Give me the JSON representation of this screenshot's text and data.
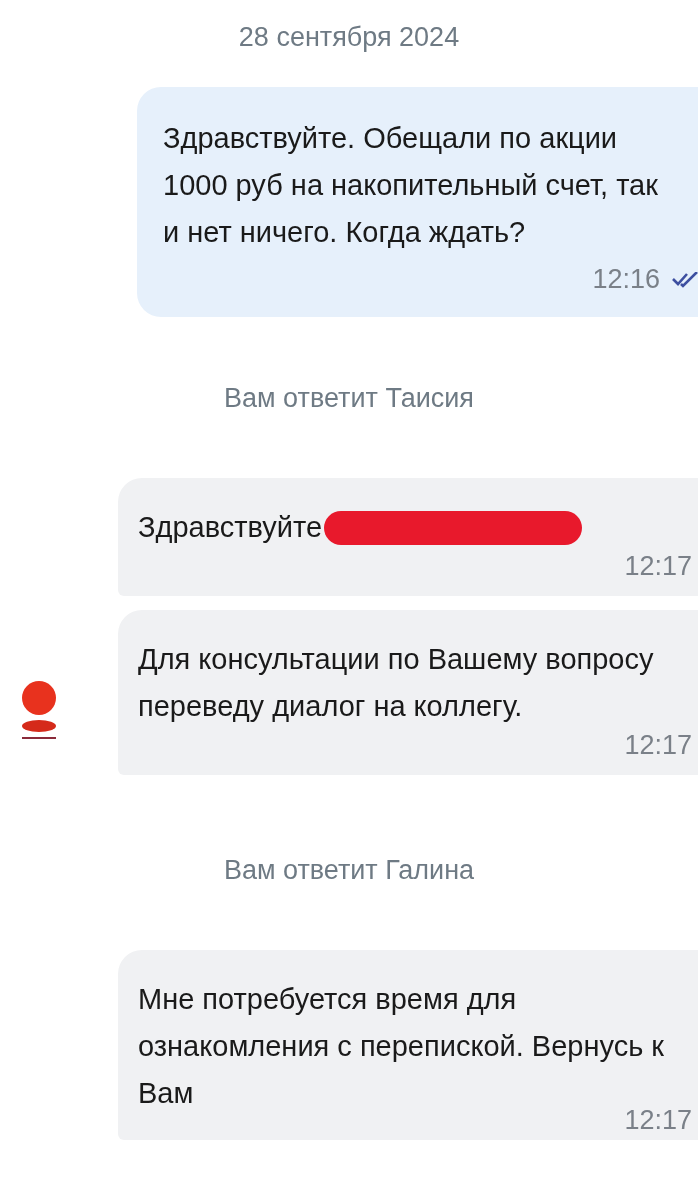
{
  "messages": [
    {
      "kind": "date",
      "text": "28 сентября 2024"
    },
    {
      "kind": "outgoing",
      "text": "Здравствуйте. Обещали по акции 1000 руб на накопительный счет, так и нет ничего. Когда ждать?",
      "time": "12:16",
      "read": true
    },
    {
      "kind": "system",
      "text": "Вам ответит Таисия"
    },
    {
      "kind": "incoming",
      "text": "Здравствуйте",
      "redacted": true,
      "avatar": false,
      "time": "12:17"
    },
    {
      "kind": "incoming",
      "text": "Для консультации по Вашему вопросу переведу диалог на коллегу.",
      "redacted": false,
      "avatar": true,
      "time": "12:17"
    },
    {
      "kind": "system",
      "text": "Вам ответит Галина"
    },
    {
      "kind": "incoming",
      "text": "Мне потребуется время для ознакомления с перепиской. Вернусь к Вам",
      "redacted": false,
      "avatar": false,
      "time": "12:17"
    }
  ]
}
